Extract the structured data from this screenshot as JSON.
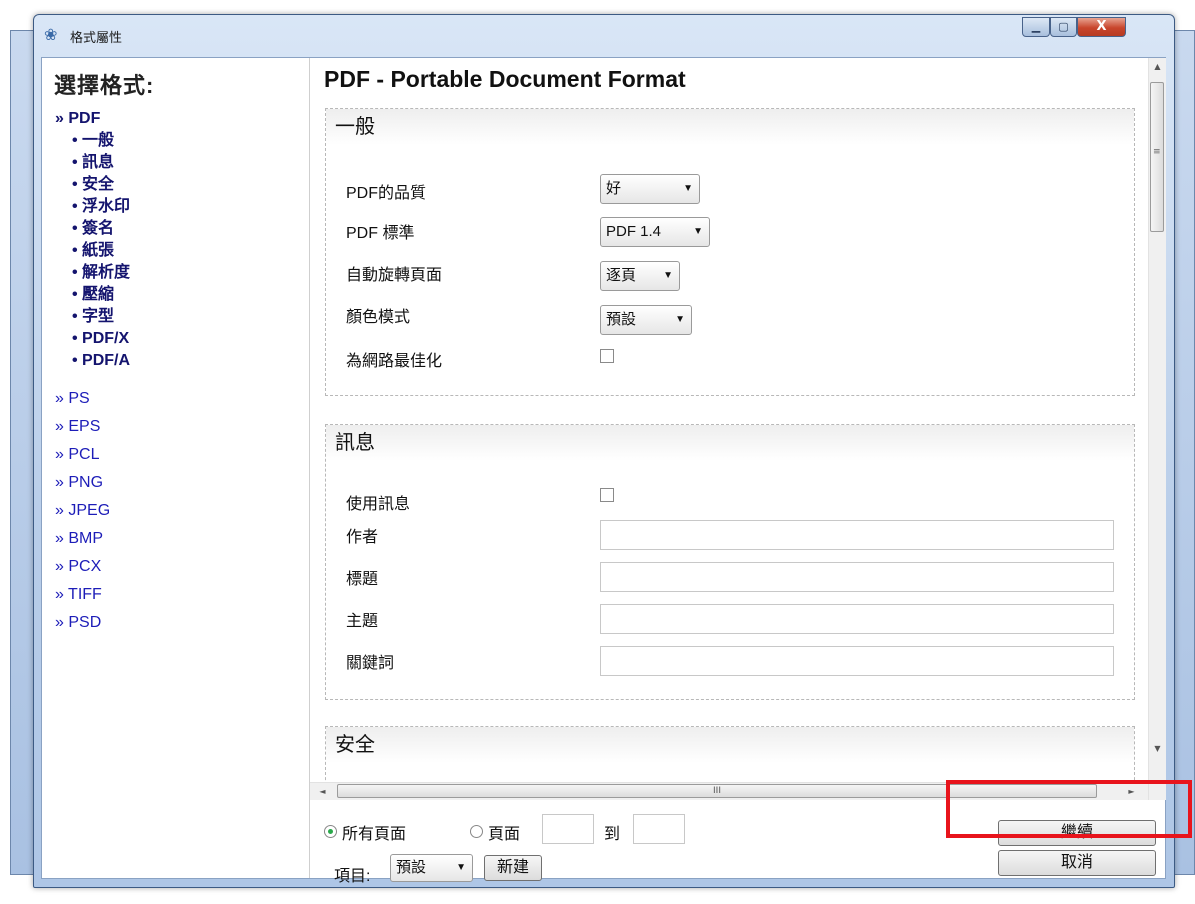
{
  "window": {
    "title": "格式屬性",
    "min_symbol": "▁",
    "max_symbol": "▢",
    "close_symbol": "X",
    "icon": "app-icon"
  },
  "sidebar": {
    "title": "選擇格式:",
    "active": "» PDF",
    "pdf_subitems": [
      "• 一般",
      "• 訊息",
      "• 安全",
      "• 浮水印",
      "• 簽名",
      "• 紙張",
      "• 解析度",
      "• 壓縮",
      "• 字型",
      "• PDF/X",
      "• PDF/A"
    ],
    "formats": [
      "» PS",
      "» EPS",
      "» PCL",
      "» PNG",
      "» JPEG",
      "» BMP",
      "» PCX",
      "» TIFF",
      "» PSD"
    ]
  },
  "main": {
    "title": "PDF - Portable Document Format",
    "general": {
      "heading": "一般",
      "quality_label": "PDF的品質",
      "quality_value": "好",
      "standard_label": "PDF 標準",
      "standard_value": "PDF 1.4",
      "rotate_label": "自動旋轉頁面",
      "rotate_value": "逐頁",
      "color_label": "顏色模式",
      "color_value": "預設",
      "optimize_label": "為網路最佳化",
      "optimize_checked": false
    },
    "info": {
      "heading": "訊息",
      "use_label": "使用訊息",
      "use_checked": false,
      "author_label": "作者",
      "author_value": "",
      "title_label": "標題",
      "title_value": "",
      "subject_label": "主題",
      "subject_value": "",
      "keywords_label": "關鍵詞",
      "keywords_value": ""
    },
    "security": {
      "heading": "安全"
    }
  },
  "bottom": {
    "all_pages_label": "所有頁面",
    "all_pages_selected": true,
    "pages_label": "頁面",
    "to_label": "到",
    "from_value": "",
    "to_value": "",
    "profile_label": "項目:",
    "profile_value": "預設",
    "new_label": "新建",
    "continue_label": "繼續",
    "cancel_label": "取消"
  },
  "scrollbar": {
    "grip": "≡",
    "hgrip": "III",
    "up": "▲",
    "down": "▼",
    "left": "◄",
    "right": "►"
  },
  "colors": {
    "highlight": "#e8141c",
    "link": "#1d1db8",
    "active_nav": "#14146e"
  }
}
